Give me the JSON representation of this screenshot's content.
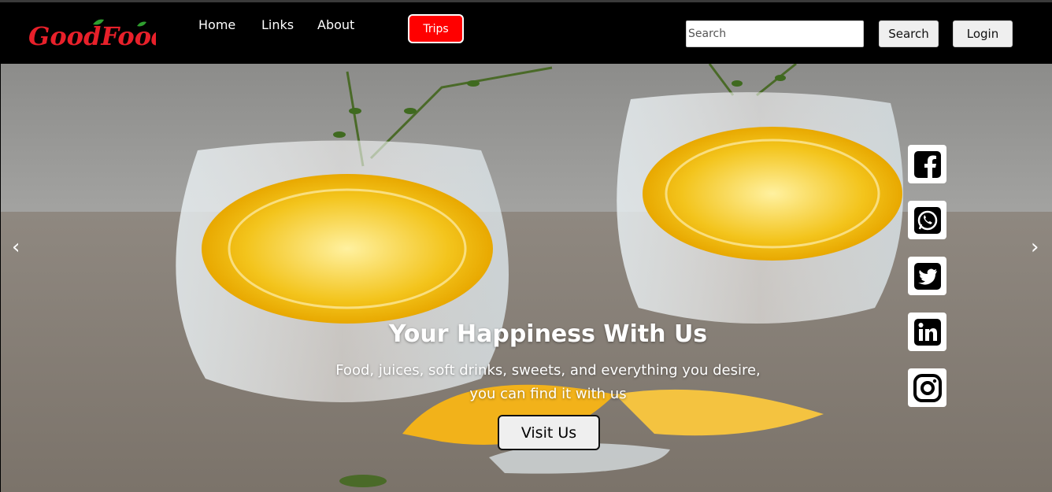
{
  "brand": {
    "logo_text": "GoodFood",
    "logo_color": "#e8202a",
    "leaf_color": "#2f9e2f"
  },
  "nav": {
    "home": "Home",
    "links": "Links",
    "about": "About",
    "trips": "Trips",
    "trips_color": "#ff0000"
  },
  "search": {
    "placeholder": "Search",
    "button": "Search"
  },
  "login": {
    "label": "Login"
  },
  "hero": {
    "title": "Your Happiness With Us",
    "subtitle_line1": "Food, juices, soft drinks, sweets, and everything you desire,",
    "subtitle_line2": "you can find it with us",
    "cta": "Visit Us",
    "prev_arrow": "‹",
    "next_arrow": "›"
  },
  "social": [
    {
      "name": "facebook-icon"
    },
    {
      "name": "whatsapp-icon"
    },
    {
      "name": "twitter-icon"
    },
    {
      "name": "linkedin-icon"
    },
    {
      "name": "instagram-icon"
    }
  ]
}
